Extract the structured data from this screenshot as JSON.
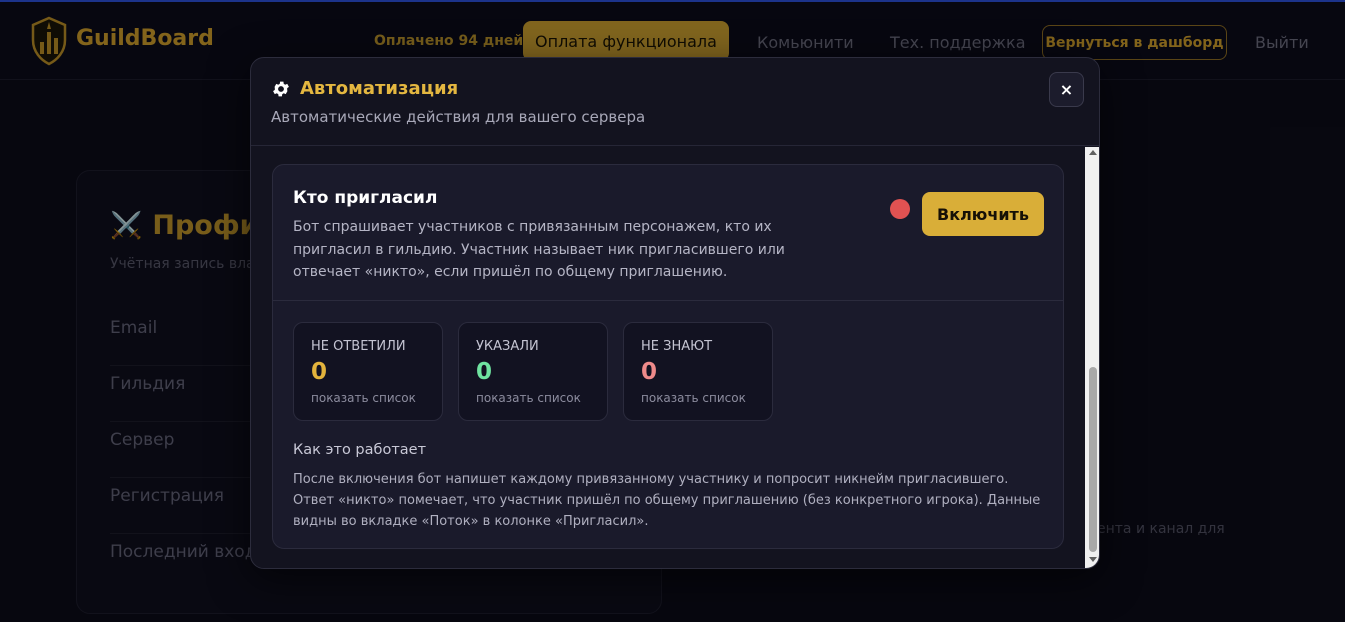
{
  "navbar": {
    "brand": "GuildBoard",
    "paid_status": "Оплачено 94 дней",
    "pay_button": "Оплата функционала",
    "community_link": "Комьюнити",
    "support_link": "Тех. поддержка",
    "back_button": "Вернуться в дашборд",
    "logout_link": "Выйти"
  },
  "profile": {
    "icon": "crossed-swords-icon",
    "title": "Профи",
    "subtitle": "Учётная запись вла",
    "rows": [
      "Email",
      "Гильдия",
      "Сервер",
      "Регистрация",
      "Последний вход"
    ]
  },
  "background_note": "ента и канал для",
  "modal": {
    "icon": "gear-icon",
    "title": "Автоматизация",
    "subtitle": "Автоматические действия для вашего сервера",
    "close_label": "×",
    "card": {
      "title": "Кто пригласил",
      "description": "Бот спрашивает участников с привязанным персонажем, кто их пригласил в гильдию. Участник называет ник пригласившего или отвечает «никто», если пришёл по общему приглашению.",
      "status_color": "#e05252",
      "enable_button": "Включить",
      "stats": [
        {
          "label": "НЕ ОТВЕТИЛИ",
          "value": "0",
          "color": "#e3b33c",
          "link": "показать список"
        },
        {
          "label": "УКАЗАЛИ",
          "value": "0",
          "color": "#6fe3a0",
          "link": "показать список"
        },
        {
          "label": "НЕ ЗНАЮТ",
          "value": "0",
          "color": "#ee8a8a",
          "link": "показать список"
        }
      ],
      "how_title": "Как это работает",
      "how_text": "После включения бот напишет каждому привязанному участнику и попросит никнейм пригласившего. Ответ «никто» помечает, что участник пришёл по общему приглашению (без конкретного игрока). Данные видны во вкладке «Поток» в колонке «Пригласил»."
    }
  }
}
